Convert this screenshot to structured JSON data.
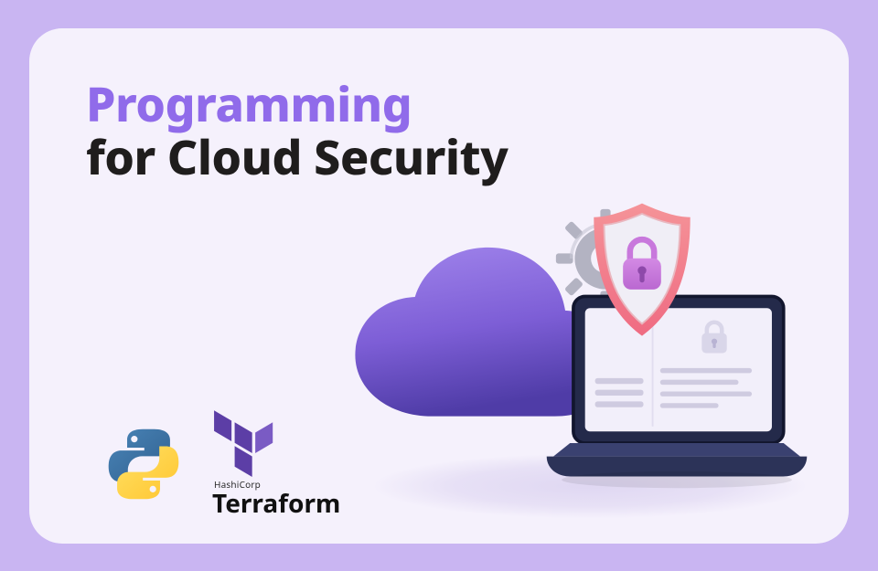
{
  "heading": {
    "line1": "Programming",
    "line2": "for Cloud Security"
  },
  "logos": {
    "python": {
      "name": "python-logo-icon"
    },
    "terraform": {
      "vendor": "HashiCorp",
      "product": "Terraform",
      "name": "terraform-logo-icon"
    }
  },
  "illustration": {
    "elements": [
      "cloud-icon",
      "gear-icon",
      "laptop-icon",
      "shield-lock-icon"
    ]
  },
  "colors": {
    "page_bg": "#c9b5f2",
    "card_bg": "#f5f1fc",
    "accent_purple": "#906bea",
    "accent_dark": "#1f1d1d",
    "cloud_top": "#9a7be9",
    "cloud_bottom": "#5b44b8",
    "gear": "#9f9fb0",
    "laptop_body": "#2f3657",
    "laptop_lid": "#1e2340",
    "screen_bg": "#f5f3fb",
    "shield_border": "#f07d8a",
    "shield_inner": "#ececf5",
    "lock": "#bf6ad7",
    "terraform_purple": "#5c3ea6",
    "python_blue": "#3d6fa3",
    "python_yellow": "#ffd048"
  }
}
